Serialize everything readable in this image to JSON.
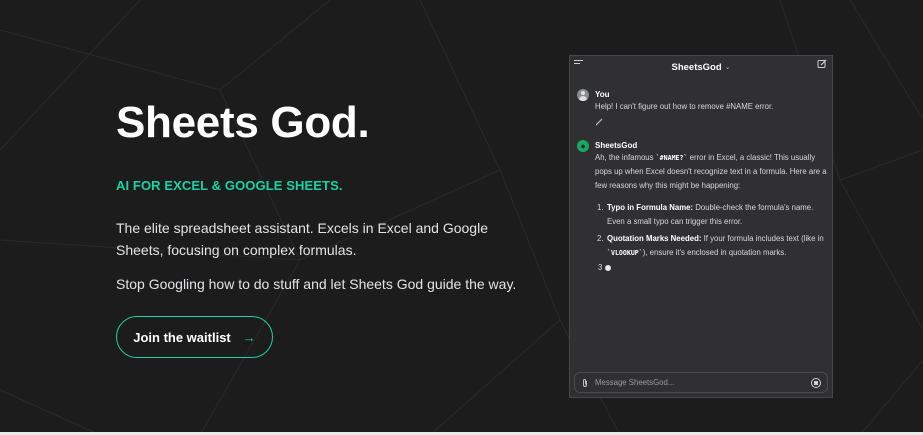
{
  "hero": {
    "title": "Sheets God.",
    "tagline": "AI FOR EXCEL & GOOGLE SHEETS.",
    "description": "The elite spreadsheet assistant. Excels in Excel and Google Sheets, focusing on complex formulas.",
    "description2": "Stop Googling how to do stuff and let Sheets God guide the way.",
    "cta_label": "Join the waitlist",
    "cta_arrow": "→"
  },
  "chat": {
    "header_title": "SheetsGod",
    "header_chevron": "⌄",
    "user_message": {
      "name": "You",
      "text": "Help!  I can't figure out how to remove #NAME error."
    },
    "bot_message": {
      "name": "SheetsGod",
      "text_before_code": "Ah, the infamous ",
      "code": "`#NAME?`",
      "text_after_code": " error in Excel, a classic! This usually pops up when Excel doesn't recognize text in a formula. Here are a few reasons why this might be happening:",
      "list": [
        {
          "num": "1.",
          "bold": "Typo in Formula Name:",
          "text": " Double-check the formula's name. Even a small typo can trigger this error."
        },
        {
          "num": "2.",
          "bold": "Quotation Marks Needed:",
          "text_before_code": " If your formula includes text (like in ",
          "code": "`VLOOKUP`",
          "text_after_code": "), ensure it's enclosed in quotation marks."
        }
      ],
      "streaming_number": "3"
    },
    "composer_placeholder": "Message SheetsGod..."
  },
  "colors": {
    "accent": "#19d3a2",
    "background": "#1c1c1d",
    "chat_bg": "#303032"
  },
  "icons": {
    "menu": "menu-icon",
    "edit": "edit-icon",
    "pencil": "pencil-icon",
    "attach": "paperclip-icon",
    "stop": "stop-icon",
    "arrow": "arrow-right-icon"
  }
}
